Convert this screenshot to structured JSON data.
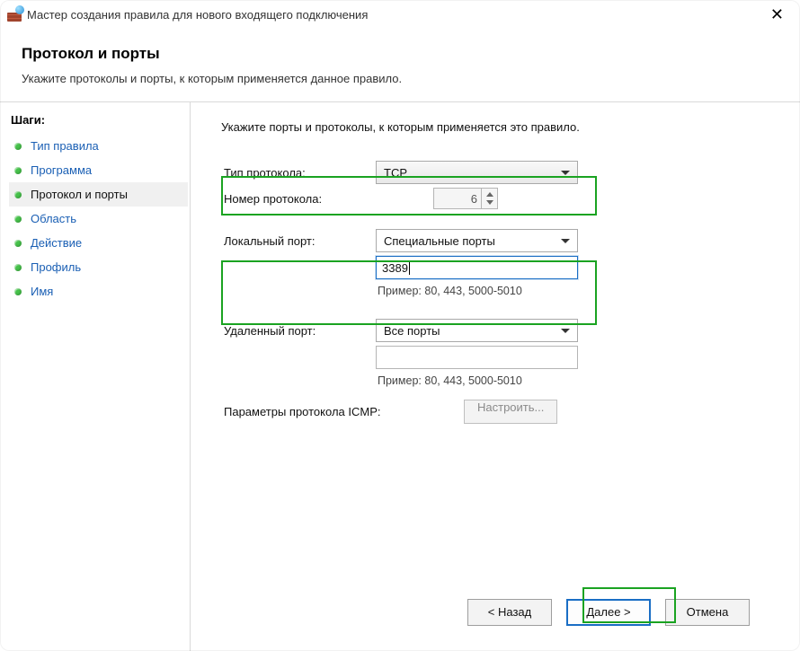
{
  "titlebar": {
    "title": "Мастер создания правила для нового входящего подключения"
  },
  "header": {
    "title": "Протокол и порты",
    "subtitle": "Укажите протоколы и порты, к которым применяется данное правило."
  },
  "sidebar": {
    "title": "Шаги:",
    "items": [
      {
        "label": "Тип правила",
        "current": false
      },
      {
        "label": "Программа",
        "current": false
      },
      {
        "label": "Протокол и порты",
        "current": true
      },
      {
        "label": "Область",
        "current": false
      },
      {
        "label": "Действие",
        "current": false
      },
      {
        "label": "Профиль",
        "current": false
      },
      {
        "label": "Имя",
        "current": false
      }
    ]
  },
  "main": {
    "instruction": "Укажите порты и протоколы, к которым применяется это правило.",
    "labels": {
      "protocol_type": "Тип протокола:",
      "protocol_number": "Номер протокола:",
      "local_port": "Локальный порт:",
      "remote_port": "Удаленный порт:",
      "icmp": "Параметры протокола ICMP:"
    },
    "values": {
      "protocol_type": "TCP",
      "protocol_number": "6",
      "local_port_mode": "Специальные порты",
      "local_port_value": "3389",
      "remote_port_mode": "Все порты",
      "remote_port_value": ""
    },
    "hints": {
      "example": "Пример: 80, 443, 5000-5010"
    },
    "buttons": {
      "configure": "Настроить..."
    }
  },
  "footer": {
    "back": "< Назад",
    "next": "Далее >",
    "cancel": "Отмена"
  }
}
